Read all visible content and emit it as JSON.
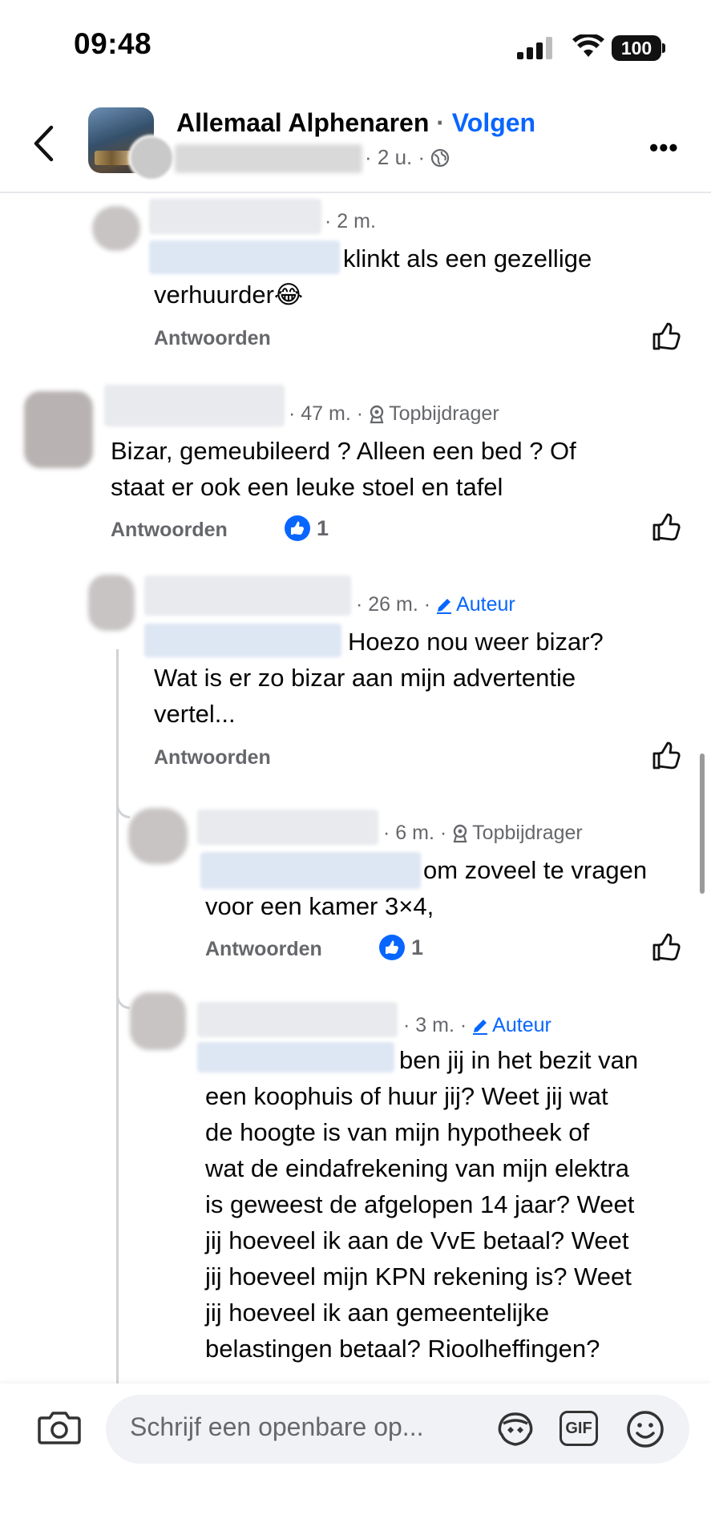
{
  "status_bar": {
    "time": "09:48",
    "battery": "100"
  },
  "header": {
    "group_name": "Allemaal Alphenaren",
    "separator": "·",
    "follow_label": "Volgen",
    "post_age": "· 2 u. ·"
  },
  "comments": [
    {
      "id": "c1",
      "age": "· 2 m.",
      "text_after_mention": "klinkt als een gezellige",
      "text_line2": "verhuurder😂",
      "reply_label": "Antwoorden"
    },
    {
      "id": "c2",
      "age": "· 47 m. ·",
      "badge": "Topbijdrager",
      "text_line1": "Bizar, gemeubileerd ? Alleen een bed ? Of",
      "text_line2": "staat er ook een leuke stoel en tafel",
      "reply_label": "Antwoorden",
      "reactions": "1"
    },
    {
      "id": "c3",
      "age": "· 26 m. ·",
      "badge": "Auteur",
      "text_after_mention": "Hoezo nou weer bizar?",
      "text_line2": "Wat is er zo bizar aan mijn advertentie",
      "text_line3": "vertel...",
      "reply_label": "Antwoorden"
    },
    {
      "id": "c4",
      "age": "· 6 m. ·",
      "badge": "Topbijdrager",
      "text_after_mention": "om zoveel te vragen",
      "text_line2": "voor een kamer 3×4,",
      "reply_label": "Antwoorden",
      "reactions": "1"
    },
    {
      "id": "c5",
      "age": "· 3 m. ·",
      "badge": "Auteur",
      "text_after_mention": "ben jij in het bezit van",
      "lines": [
        "een koophuis of huur jij? Weet jij wat",
        "de hoogte is van mijn hypotheek of",
        "wat de eindafrekening van mijn elektra",
        "is geweest de afgelopen 14 jaar? Weet",
        "jij hoeveel ik aan de VvE betaal? Weet",
        "jij hoeveel mijn KPN rekening is? Weet",
        "jij hoeveel ik aan gemeentelijke",
        "belastingen betaal? Rioolheffingen?"
      ]
    }
  ],
  "composer": {
    "placeholder": "Schrijf een openbare op...",
    "gif_label": "GIF"
  },
  "colors": {
    "accent": "#0866ff",
    "secondary_text": "#65676b",
    "divider": "#e4e6eb"
  }
}
